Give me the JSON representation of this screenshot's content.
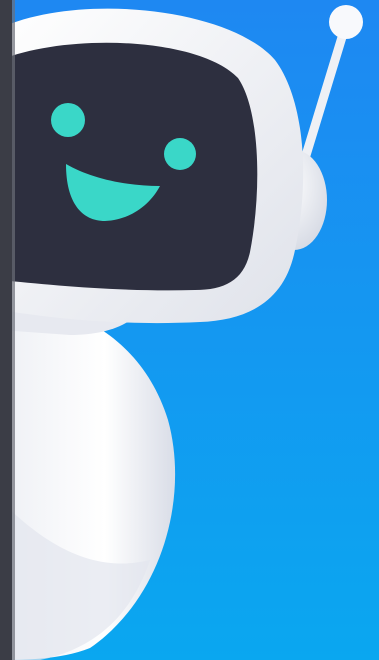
{
  "illustration": {
    "subject": "robot-peeking-icon",
    "colors": {
      "background_top": "#1e88f2",
      "background_bottom": "#0aa7f0",
      "robot_shell": "#f6f7fb",
      "robot_shadow": "#d7dbe6",
      "face_screen": "#2d2f3f",
      "face_features": "#3ad7c8",
      "left_bezel": "#3b3d46"
    }
  }
}
